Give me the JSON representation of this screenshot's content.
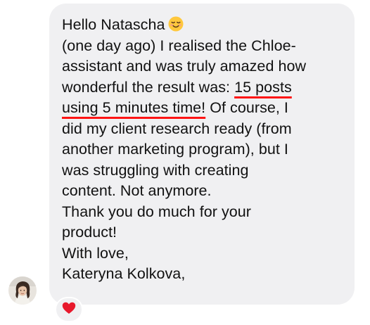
{
  "message": {
    "greeting": "Hello Natascha",
    "greeting_emoji": "smiling-face-icon",
    "line2": "(one day ago) I realised the Chloe-",
    "line3": "assistant and was truly amazed how",
    "line4_pre": "wonderful the result was: ",
    "line4_hl": "15 posts",
    "line5_hl": "using 5 minutes time!",
    "line5_post": " Of course, I",
    "line6": "did my client research ready (from",
    "line7": "another marketing program), but I",
    "line8": "was struggling with creating",
    "line9": "content. Not anymore.",
    "line10": "Thank you do much for your",
    "line11": "product!",
    "line12": "With love,",
    "line13": "Kateryna Kolkova,"
  },
  "reaction": {
    "icon": "heart-icon",
    "color": "#e8192c"
  },
  "colors": {
    "bubble": "#f0f0f2",
    "text": "#111111",
    "underline": "#ff1414"
  }
}
